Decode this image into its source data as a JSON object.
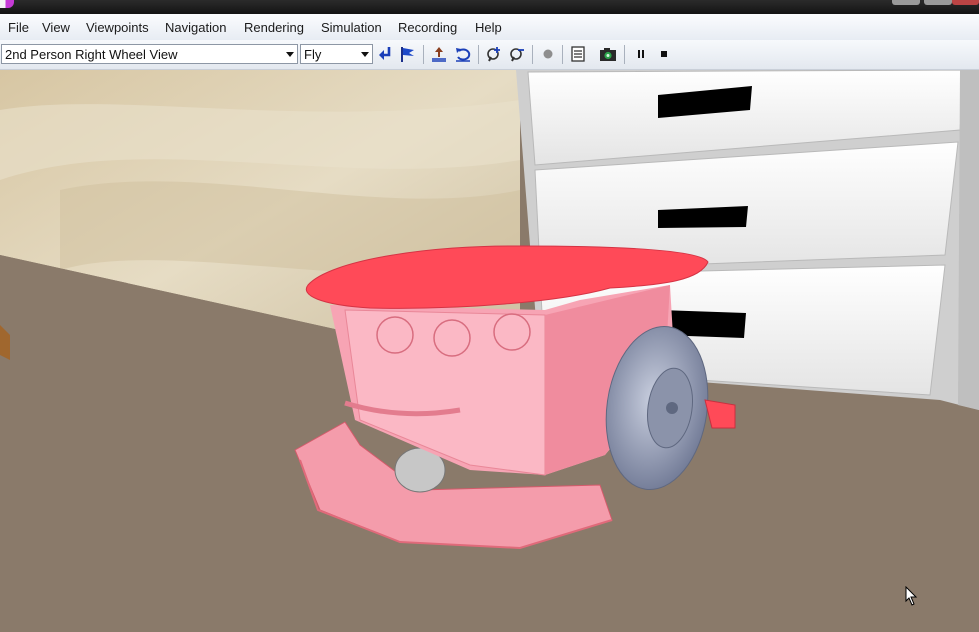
{
  "menubar": {
    "items": [
      {
        "label": "File"
      },
      {
        "label": "View"
      },
      {
        "label": "Viewpoints"
      },
      {
        "label": "Navigation"
      },
      {
        "label": "Rendering"
      },
      {
        "label": "Simulation"
      },
      {
        "label": "Recording"
      },
      {
        "label": "Help"
      }
    ]
  },
  "toolbar": {
    "viewpoint_select": "2nd Person Right Wheel View",
    "navigation_select": "Fly",
    "icons": [
      "return-arrow-icon",
      "flag-icon",
      "lift-icon",
      "undo-rotate-icon",
      "zoom-in-icon",
      "zoom-out-icon",
      "record-dot-icon",
      "document-icon",
      "camera-icon",
      "pause-icon",
      "stop-icon"
    ]
  },
  "colors": {
    "robot_body": "#f7a4b4",
    "robot_top": "#ff4a58",
    "floor": "#8a7a6a",
    "drawer_cabinet": "#f0f0f0",
    "wheel": "#9aa2b8"
  }
}
